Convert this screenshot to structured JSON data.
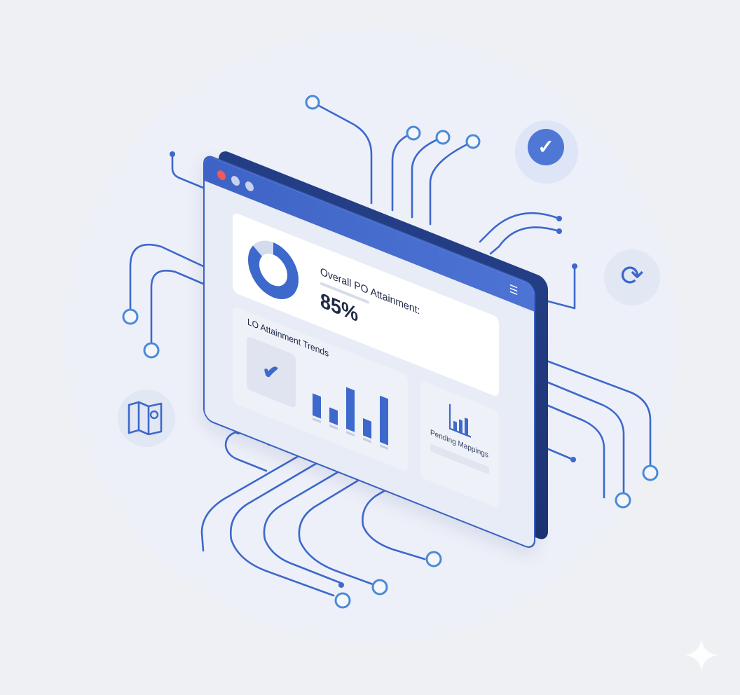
{
  "dashboard": {
    "overall_label": "Overall PO Attainment:",
    "overall_value": "85%",
    "overall_percent": 85,
    "trends_label": "LO Attainment Trends",
    "trend_bars": [
      0.45,
      0.3,
      0.85,
      0.35,
      0.95
    ],
    "pending_label": "Pending Mappings"
  },
  "icons": {
    "window_menu": "menu-icon",
    "donut": "donut-chart-icon",
    "check": "checkmark-icon",
    "badge_check": "check-bubble-icon",
    "badge_sync": "sync-icon",
    "badge_map": "map-icon",
    "pending": "bar-chart-icon",
    "sparkle": "sparkle-icon"
  },
  "colors": {
    "accent": "#3d68cc",
    "window_dark": "#1c3473",
    "node": "#4a8ad8",
    "close_dot": "#ef5a5a"
  }
}
